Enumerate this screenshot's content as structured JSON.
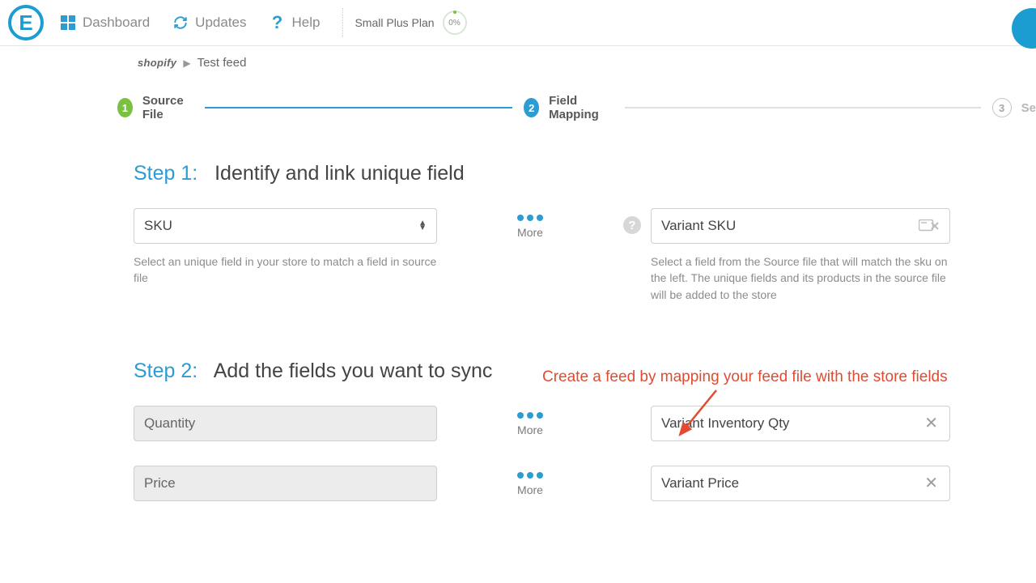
{
  "topnav": {
    "dashboard": "Dashboard",
    "updates": "Updates",
    "help": "Help",
    "plan": "Small Plus Plan",
    "pct": "0%"
  },
  "breadcrumb": {
    "store": "shopify",
    "feed": "Test feed"
  },
  "stepper": {
    "s1_num": "1",
    "s1_label": "Source File",
    "s2_num": "2",
    "s2_label": "Field Mapping",
    "s3_num": "3",
    "s3_label": "Se"
  },
  "step1": {
    "head_num": "Step 1:",
    "head_rest": "Identify and link unique field",
    "left_select": "SKU",
    "left_helper": "Select an unique field in your store to match a field in source file",
    "right_value": "Variant SKU",
    "right_helper": "Select a field from the Source file that will match the sku on the left. The unique fields and its products in the source file will be added to the store",
    "more": "More"
  },
  "step2": {
    "head_num": "Step 2:",
    "head_rest": "Add the fields you want to sync",
    "rows": [
      {
        "left": "Quantity",
        "right": "Variant Inventory Qty"
      },
      {
        "left": "Price",
        "right": "Variant Price"
      }
    ],
    "more": "More"
  },
  "annotation": "Create a feed by mapping your feed file with the store fields"
}
